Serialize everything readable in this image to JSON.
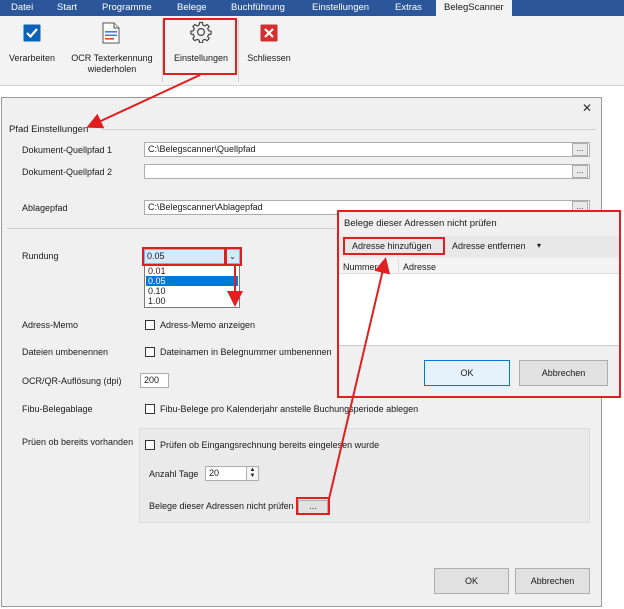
{
  "menu": {
    "tabs": [
      {
        "label": "Datei"
      },
      {
        "label": "Start"
      },
      {
        "label": "Programme"
      },
      {
        "label": "Belege"
      },
      {
        "label": "Buchführung"
      },
      {
        "label": "Einstellungen"
      },
      {
        "label": "Extras"
      },
      {
        "label": "BelegScanner"
      }
    ]
  },
  "ribbon": {
    "verarbeiten": "Verarbeiten",
    "ocr_line1": "OCR Texterkennung",
    "ocr_line2": "wiederholen",
    "einstellungen": "Einstellungen",
    "schliessen": "Schliessen"
  },
  "dialog": {
    "close_label": "✕",
    "section_title": "Pfad Einstellungen",
    "quellpfad1_label": "Dokument-Quellpfad 1",
    "quellpfad1_value": "C:\\Belegscanner\\Quellpfad",
    "quellpfad2_label": "Dokument-Quellpfad 2",
    "quellpfad2_value": "",
    "ablagepfad_label": "Ablagepfad",
    "ablagepfad_value": "C:\\Belegscanner\\Ablagepfad",
    "browse_label": "...",
    "rundung_label": "Rundung",
    "rundung_value": "0.05",
    "rundung_options": [
      "0.01",
      "0.05",
      "0.10",
      "1.00"
    ],
    "adress_memo_label": "Adress-Memo",
    "adress_memo_check": "Adress-Memo anzeigen",
    "dateien_label": "Dateien umbenennen",
    "dateien_check": "Dateinamen in Belegnummer umbenennen",
    "ocr_label": "OCR/QR-Auflösung (dpi)",
    "ocr_value": "200",
    "fibu_label": "Fibu-Belegablage",
    "fibu_check": "Fibu-Belege pro Kalenderjahr anstelle Buchungsperiode ablegen",
    "pruef_label": "Prüen ob bereits vorhanden",
    "pruef_check": "Prüfen ob Eingangsrechnung bereits eingelesen wurde",
    "anzahl_label": "Anzahl Tage",
    "anzahl_value": "20",
    "belege_label": "Belege dieser Adressen nicht prüfen",
    "belege_button": "...",
    "ok_label": "OK",
    "cancel_label": "Abbrechen"
  },
  "popup": {
    "title": "Belege dieser Adressen nicht prüfen",
    "add_label": "Adresse hinzufügen",
    "remove_label": "Adresse entfernen",
    "col_nummer": "Nummer",
    "col_adresse": "Adresse",
    "ok_label": "OK",
    "cancel_label": "Abbrechen"
  },
  "colors": {
    "ribbon_blue": "#2b579a",
    "annotation_red": "#e02020",
    "selection_blue": "#0078d7"
  }
}
